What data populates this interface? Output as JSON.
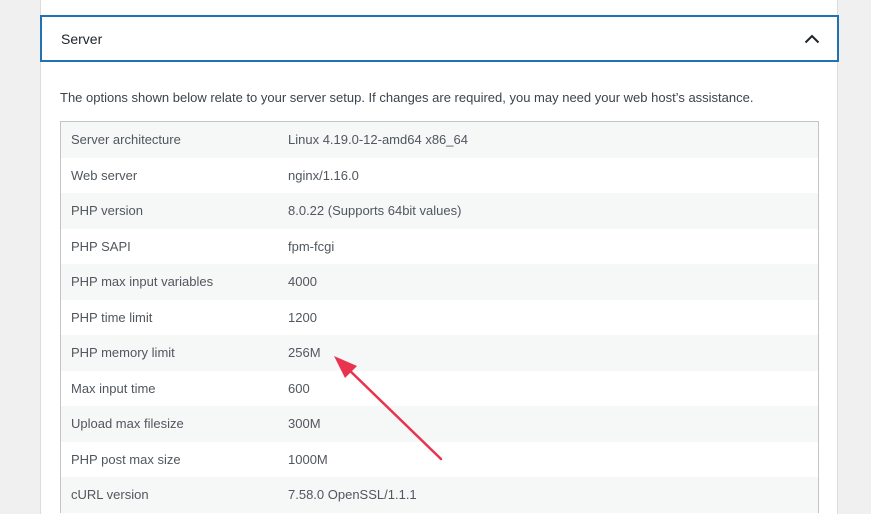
{
  "section": {
    "title": "Server",
    "intro": "The options shown below relate to your server setup. If changes are required, you may need your web host’s assistance."
  },
  "rows": [
    {
      "key": "Server architecture",
      "value": "Linux 4.19.0-12-amd64 x86_64"
    },
    {
      "key": "Web server",
      "value": "nginx/1.16.0"
    },
    {
      "key": "PHP version",
      "value": "8.0.22 (Supports 64bit values)"
    },
    {
      "key": "PHP SAPI",
      "value": "fpm-fcgi"
    },
    {
      "key": "PHP max input variables",
      "value": "4000"
    },
    {
      "key": "PHP time limit",
      "value": "1200"
    },
    {
      "key": "PHP memory limit",
      "value": "256M"
    },
    {
      "key": "Max input time",
      "value": "600"
    },
    {
      "key": "Upload max filesize",
      "value": "300M"
    },
    {
      "key": "PHP post max size",
      "value": "1000M"
    },
    {
      "key": "cURL version",
      "value": "7.58.0 OpenSSL/1.1.1"
    }
  ],
  "colors": {
    "accent": "#2271b1",
    "annotation_arrow": "#e8344e"
  },
  "icons": {
    "toggle": "chevron-up-icon",
    "annotation": "arrow-annotation"
  }
}
